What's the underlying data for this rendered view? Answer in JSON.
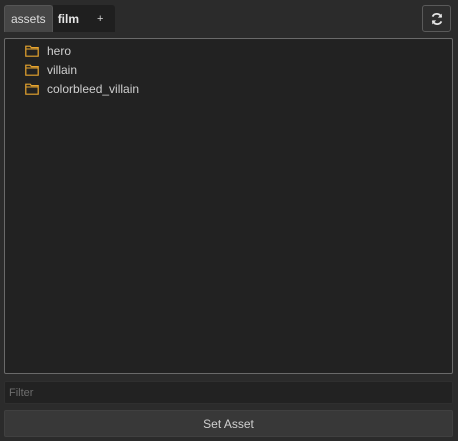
{
  "tabs": [
    {
      "label": "assets",
      "active": true
    },
    {
      "label": "film",
      "active": false
    },
    {
      "label": "+",
      "active": false
    }
  ],
  "refresh": {
    "icon": "refresh-icon"
  },
  "tree": {
    "items": [
      {
        "label": "hero",
        "icon": "folder-icon"
      },
      {
        "label": "villain",
        "icon": "folder-icon"
      },
      {
        "label": "colorbleed_villain",
        "icon": "folder-icon"
      }
    ]
  },
  "filter": {
    "placeholder": "Filter",
    "value": ""
  },
  "set_asset": {
    "label": "Set Asset"
  },
  "colors": {
    "background": "#2b2b2b",
    "panel": "#222222",
    "folder": "#e8a52e",
    "text": "#cfcfcf"
  }
}
